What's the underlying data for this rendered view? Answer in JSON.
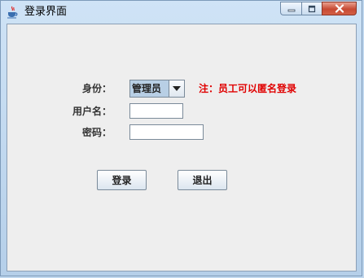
{
  "window": {
    "title": "登录界面",
    "controls": {
      "minimize_icon": "minimize-icon",
      "maximize_icon": "maximize-icon",
      "close_icon": "close-icon"
    },
    "app_icon": "java-coffee-icon"
  },
  "form": {
    "identity_label": "身份：",
    "identity_value": "管理员",
    "identity_note": "注：员工可以匿名登录",
    "username_label": "用户名：",
    "username_value": "",
    "password_label": "密码：",
    "password_value": ""
  },
  "buttons": {
    "login": "登录",
    "exit": "退出"
  },
  "colors": {
    "note": "#e00000",
    "titlebar": "#cfe3f6",
    "client_bg": "#eeeeee",
    "combo_selected": "#b8cfe5"
  }
}
